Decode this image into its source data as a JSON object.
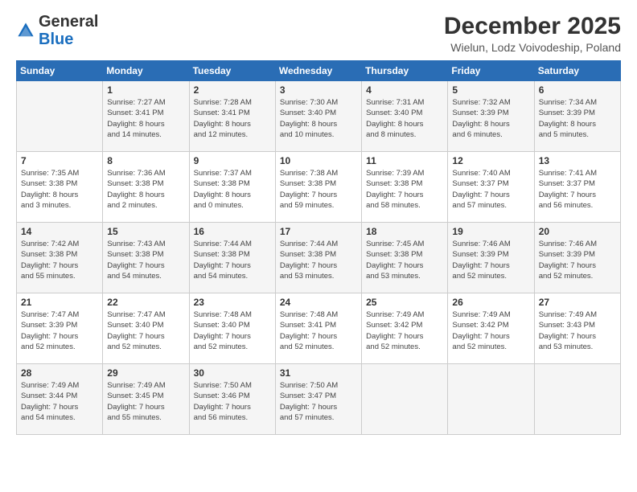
{
  "header": {
    "logo_general": "General",
    "logo_blue": "Blue",
    "title": "December 2025",
    "location": "Wielun, Lodz Voivodeship, Poland"
  },
  "calendar": {
    "days_of_week": [
      "Sunday",
      "Monday",
      "Tuesday",
      "Wednesday",
      "Thursday",
      "Friday",
      "Saturday"
    ],
    "weeks": [
      [
        {
          "day": "",
          "info": ""
        },
        {
          "day": "1",
          "info": "Sunrise: 7:27 AM\nSunset: 3:41 PM\nDaylight: 8 hours\nand 14 minutes."
        },
        {
          "day": "2",
          "info": "Sunrise: 7:28 AM\nSunset: 3:41 PM\nDaylight: 8 hours\nand 12 minutes."
        },
        {
          "day": "3",
          "info": "Sunrise: 7:30 AM\nSunset: 3:40 PM\nDaylight: 8 hours\nand 10 minutes."
        },
        {
          "day": "4",
          "info": "Sunrise: 7:31 AM\nSunset: 3:40 PM\nDaylight: 8 hours\nand 8 minutes."
        },
        {
          "day": "5",
          "info": "Sunrise: 7:32 AM\nSunset: 3:39 PM\nDaylight: 8 hours\nand 6 minutes."
        },
        {
          "day": "6",
          "info": "Sunrise: 7:34 AM\nSunset: 3:39 PM\nDaylight: 8 hours\nand 5 minutes."
        }
      ],
      [
        {
          "day": "7",
          "info": "Sunrise: 7:35 AM\nSunset: 3:38 PM\nDaylight: 8 hours\nand 3 minutes."
        },
        {
          "day": "8",
          "info": "Sunrise: 7:36 AM\nSunset: 3:38 PM\nDaylight: 8 hours\nand 2 minutes."
        },
        {
          "day": "9",
          "info": "Sunrise: 7:37 AM\nSunset: 3:38 PM\nDaylight: 8 hours\nand 0 minutes."
        },
        {
          "day": "10",
          "info": "Sunrise: 7:38 AM\nSunset: 3:38 PM\nDaylight: 7 hours\nand 59 minutes."
        },
        {
          "day": "11",
          "info": "Sunrise: 7:39 AM\nSunset: 3:38 PM\nDaylight: 7 hours\nand 58 minutes."
        },
        {
          "day": "12",
          "info": "Sunrise: 7:40 AM\nSunset: 3:37 PM\nDaylight: 7 hours\nand 57 minutes."
        },
        {
          "day": "13",
          "info": "Sunrise: 7:41 AM\nSunset: 3:37 PM\nDaylight: 7 hours\nand 56 minutes."
        }
      ],
      [
        {
          "day": "14",
          "info": "Sunrise: 7:42 AM\nSunset: 3:38 PM\nDaylight: 7 hours\nand 55 minutes."
        },
        {
          "day": "15",
          "info": "Sunrise: 7:43 AM\nSunset: 3:38 PM\nDaylight: 7 hours\nand 54 minutes."
        },
        {
          "day": "16",
          "info": "Sunrise: 7:44 AM\nSunset: 3:38 PM\nDaylight: 7 hours\nand 54 minutes."
        },
        {
          "day": "17",
          "info": "Sunrise: 7:44 AM\nSunset: 3:38 PM\nDaylight: 7 hours\nand 53 minutes."
        },
        {
          "day": "18",
          "info": "Sunrise: 7:45 AM\nSunset: 3:38 PM\nDaylight: 7 hours\nand 53 minutes."
        },
        {
          "day": "19",
          "info": "Sunrise: 7:46 AM\nSunset: 3:39 PM\nDaylight: 7 hours\nand 52 minutes."
        },
        {
          "day": "20",
          "info": "Sunrise: 7:46 AM\nSunset: 3:39 PM\nDaylight: 7 hours\nand 52 minutes."
        }
      ],
      [
        {
          "day": "21",
          "info": "Sunrise: 7:47 AM\nSunset: 3:39 PM\nDaylight: 7 hours\nand 52 minutes."
        },
        {
          "day": "22",
          "info": "Sunrise: 7:47 AM\nSunset: 3:40 PM\nDaylight: 7 hours\nand 52 minutes."
        },
        {
          "day": "23",
          "info": "Sunrise: 7:48 AM\nSunset: 3:40 PM\nDaylight: 7 hours\nand 52 minutes."
        },
        {
          "day": "24",
          "info": "Sunrise: 7:48 AM\nSunset: 3:41 PM\nDaylight: 7 hours\nand 52 minutes."
        },
        {
          "day": "25",
          "info": "Sunrise: 7:49 AM\nSunset: 3:42 PM\nDaylight: 7 hours\nand 52 minutes."
        },
        {
          "day": "26",
          "info": "Sunrise: 7:49 AM\nSunset: 3:42 PM\nDaylight: 7 hours\nand 52 minutes."
        },
        {
          "day": "27",
          "info": "Sunrise: 7:49 AM\nSunset: 3:43 PM\nDaylight: 7 hours\nand 53 minutes."
        }
      ],
      [
        {
          "day": "28",
          "info": "Sunrise: 7:49 AM\nSunset: 3:44 PM\nDaylight: 7 hours\nand 54 minutes."
        },
        {
          "day": "29",
          "info": "Sunrise: 7:49 AM\nSunset: 3:45 PM\nDaylight: 7 hours\nand 55 minutes."
        },
        {
          "day": "30",
          "info": "Sunrise: 7:50 AM\nSunset: 3:46 PM\nDaylight: 7 hours\nand 56 minutes."
        },
        {
          "day": "31",
          "info": "Sunrise: 7:50 AM\nSunset: 3:47 PM\nDaylight: 7 hours\nand 57 minutes."
        },
        {
          "day": "",
          "info": ""
        },
        {
          "day": "",
          "info": ""
        },
        {
          "day": "",
          "info": ""
        }
      ]
    ]
  }
}
